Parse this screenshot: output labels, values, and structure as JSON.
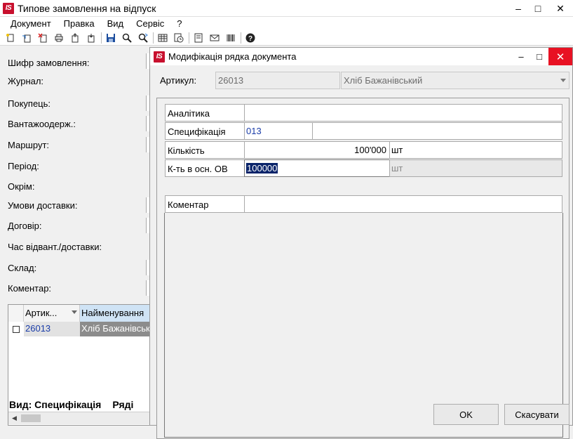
{
  "main_window": {
    "logo": "IS",
    "title": "Типове замовлення на відпуск",
    "controls": {
      "minimize": "‒",
      "maximize": "□",
      "close": "✕"
    }
  },
  "menu": [
    "Документ",
    "Правка",
    "Вид",
    "Сервіс",
    "?"
  ],
  "toolbar_icons": [
    "new-doc-icon",
    "copy-doc-icon",
    "delete-doc-icon",
    "print-icon",
    "export-icon",
    "import-icon",
    "save-icon",
    "search-icon",
    "find-next-icon",
    "table-icon",
    "clock-icon",
    "note-icon",
    "mail-icon",
    "barcode-icon",
    "help-icon"
  ],
  "form": {
    "labels": [
      "Шифр замовлення:",
      "Журнал:",
      "Покупець:",
      "Вантажоодерж.:",
      "Маршрут:",
      "Період:",
      "Окрім:",
      "Умови доставки:",
      "Договір:",
      "Час відвант./доставки:",
      "Склад:",
      "Коментар:"
    ]
  },
  "grid": {
    "columns": [
      "Артик...",
      "Найменування"
    ],
    "rows": [
      {
        "article": "26013",
        "name": "Хліб Бажанівськ"
      }
    ],
    "footer": [
      "Вид: Специфікація",
      "Ряді"
    ]
  },
  "dialog": {
    "logo": "IS",
    "title": "Модифікація рядка документа",
    "controls": {
      "minimize": "‒",
      "maximize": "□",
      "close": "✕"
    },
    "article_label": "Артикул:",
    "article_code": "26013",
    "article_name": "Хліб Бажанівський",
    "rows": {
      "analytics_label": "Аналітика",
      "analytics_value": "",
      "spec_label": "Специфікація",
      "spec_value": "013",
      "spec_extra": "",
      "qty_label": "Кількість",
      "qty_value": "100'000",
      "qty_unit": "шт",
      "qty_base_label": "К-ть в осн. ОВ",
      "qty_base_value": "100000",
      "qty_base_unit": "шт",
      "comment_label": "Коментар",
      "comment_value": ""
    },
    "ok_label": "OK",
    "cancel_label": "Скасувати"
  }
}
